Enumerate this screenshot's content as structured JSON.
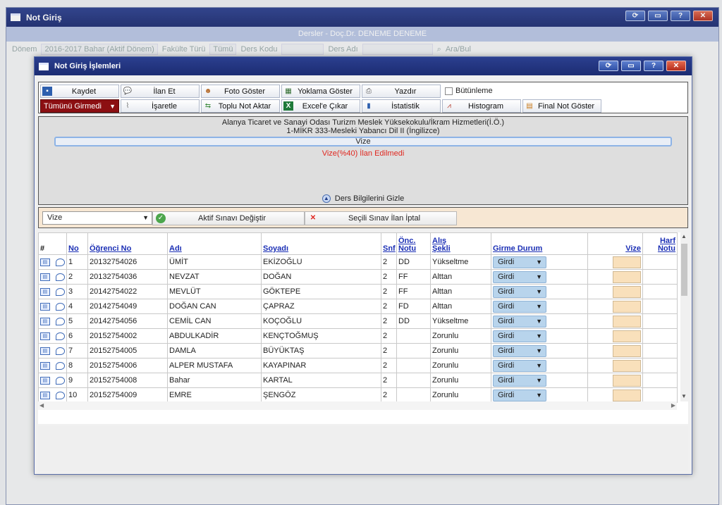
{
  "background": {
    "title": "Not Giriş",
    "subtitle": "Dersler - Doç.Dr. DENEME DENEME",
    "filters": {
      "donem_label": "Dönem",
      "donem_value": "2016-2017 Bahar (Aktif Dönem)",
      "fakulte_label": "Fakülte Türü",
      "fakulte_value": "Tümü",
      "ders_kodu_label": "Ders Kodu",
      "ders_adi_label": "Ders Adı",
      "search_label": "Ara/Bul"
    }
  },
  "dialog": {
    "title": "Not Giriş İşlemleri",
    "toolbar": {
      "kaydet": "Kaydet",
      "ilan_et": "İlan Et",
      "foto_goster": "Foto Göster",
      "yoklama_goster": "Yoklama Göster",
      "yazdir": "Yazdır",
      "butunleme": "Bütünleme",
      "tumunu_girmedi": "Tümünü Girmedi",
      "isaretle": "İşaretle",
      "toplu_not_aktar": "Toplu Not Aktar",
      "excel_cikar": "Excel'e Çıkar",
      "istatistik": "İstatistik",
      "histogram": "Histogram",
      "final_not_goster": "Final Not Göster"
    },
    "info": {
      "school": "Alanya Ticaret ve Sanayi Odası Turizm Meslek Yüksekokulu/İkram Hizmetleri(İ.Ö.)",
      "course": "1-MİKR 333-Mesleki Yabancı Dil II (İngilizce)",
      "exam_bar": "Vize",
      "warning": "Vize(%40) İlan Edilmedi",
      "hide_label": "Ders Bilgilerini Gizle"
    },
    "exam": {
      "selected": "Vize",
      "aktif_sinavi_degistir": "Aktif Sınavı Değiştir",
      "secili_sinav_ilan_iptal": "Seçili Sınav İlan İptal"
    },
    "table": {
      "headers": {
        "hash": "#",
        "no": "No",
        "ogrenci_no": "Öğrenci No",
        "adi": "Adı",
        "soyadi": "Soyadı",
        "snf": "Snf",
        "onc_notu_1": "Önc.",
        "onc_notu_2": "Notu",
        "alis_sekli_1": "Alış",
        "alis_sekli_2": "Şekli",
        "girme_durum": "Girme Durum",
        "vize": "Vize",
        "harf_notu_1": "Harf",
        "harf_notu_2": "Notu"
      },
      "rows": [
        {
          "no": "1",
          "ogrenci_no": "20132754026",
          "adi": "ÜMİT",
          "soyadi": "EKİZOĞLU",
          "snf": "2",
          "onc": "DD",
          "alis": "Yükseltme",
          "girme": "Girdi"
        },
        {
          "no": "2",
          "ogrenci_no": "20132754036",
          "adi": "NEVZAT",
          "soyadi": "DOĞAN",
          "snf": "2",
          "onc": "FF",
          "alis": "Alttan",
          "girme": "Girdi"
        },
        {
          "no": "3",
          "ogrenci_no": "20142754022",
          "adi": "MEVLÜT",
          "soyadi": "GÖKTEPE",
          "snf": "2",
          "onc": "FF",
          "alis": "Alttan",
          "girme": "Girdi"
        },
        {
          "no": "4",
          "ogrenci_no": "20142754049",
          "adi": "DOĞAN CAN",
          "soyadi": "ÇAPRAZ",
          "snf": "2",
          "onc": "FD",
          "alis": "Alttan",
          "girme": "Girdi"
        },
        {
          "no": "5",
          "ogrenci_no": "20142754056",
          "adi": "CEMİL CAN",
          "soyadi": "KOÇOĞLU",
          "snf": "2",
          "onc": "DD",
          "alis": "Yükseltme",
          "girme": "Girdi"
        },
        {
          "no": "6",
          "ogrenci_no": "20152754002",
          "adi": "ABDULKADİR",
          "soyadi": "KENÇTOĞMUŞ",
          "snf": "2",
          "onc": "",
          "alis": "Zorunlu",
          "girme": "Girdi"
        },
        {
          "no": "7",
          "ogrenci_no": "20152754005",
          "adi": "DAMLA",
          "soyadi": "BÜYÜKTAŞ",
          "snf": "2",
          "onc": "",
          "alis": "Zorunlu",
          "girme": "Girdi"
        },
        {
          "no": "8",
          "ogrenci_no": "20152754006",
          "adi": "ALPER MUSTAFA",
          "soyadi": "KAYAPINAR",
          "snf": "2",
          "onc": "",
          "alis": "Zorunlu",
          "girme": "Girdi"
        },
        {
          "no": "9",
          "ogrenci_no": "20152754008",
          "adi": "Bahar",
          "soyadi": "KARTAL",
          "snf": "2",
          "onc": "",
          "alis": "Zorunlu",
          "girme": "Girdi"
        },
        {
          "no": "10",
          "ogrenci_no": "20152754009",
          "adi": "EMRE",
          "soyadi": "ŞENGÖZ",
          "snf": "2",
          "onc": "",
          "alis": "Zorunlu",
          "girme": "Girdi"
        }
      ]
    }
  },
  "colors": {
    "title_bar": "#1c2c72",
    "tumunu_girmedi": "#8c0f12",
    "warning": "#e0271f",
    "header_link": "#1b2fb5",
    "girme_select": "#b8d4ec",
    "vize_input": "#f9e0bb"
  }
}
